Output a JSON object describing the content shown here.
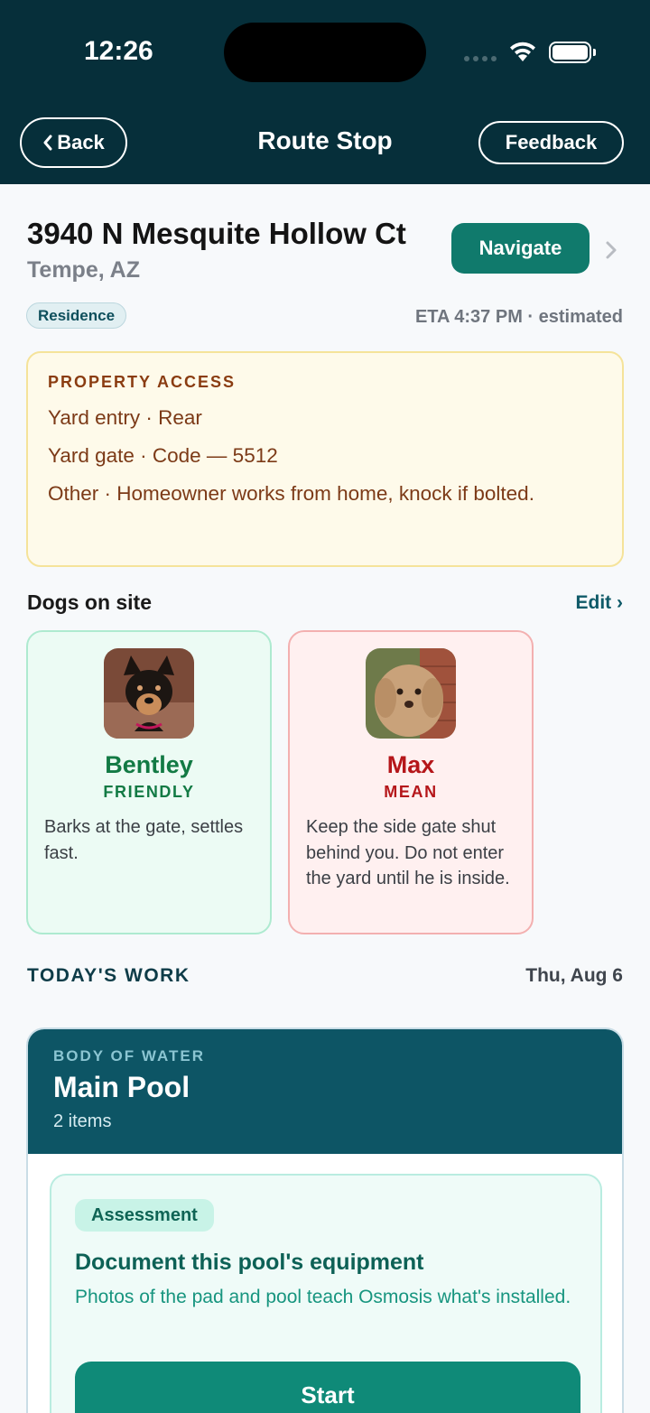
{
  "status_bar": {
    "time": "12:26"
  },
  "header": {
    "back_label": "Back",
    "title": "Route Stop",
    "feedback_label": "Feedback"
  },
  "stop": {
    "address": "3940 N Mesquite Hollow Ct",
    "city": "Tempe, AZ",
    "navigate_label": "Navigate",
    "type_badge": "Residence",
    "eta": "ETA 4:37 PM · estimated"
  },
  "property_access": {
    "title": "PROPERTY ACCESS",
    "lines": [
      "Yard entry · Rear",
      "Yard gate · Code — 5512",
      "Other · Homeowner works from home, knock if bolted."
    ]
  },
  "dogs": {
    "title": "Dogs on site",
    "edit_label": "Edit ›",
    "items": [
      {
        "name": "Bentley",
        "mood": "FRIENDLY",
        "note": "Barks at the gate, settles fast."
      },
      {
        "name": "Max",
        "mood": "MEAN",
        "note": "Keep the side gate shut behind you. Do not enter the yard until he is inside."
      }
    ]
  },
  "work": {
    "title": "TODAY'S WORK",
    "date": "Thu, Aug 6",
    "body_of_water": {
      "kicker": "BODY OF WATER",
      "name": "Main Pool",
      "count": "2 items",
      "task": {
        "badge": "Assessment",
        "title": "Document this pool's equipment",
        "description": "Photos of the pad and pool teach Osmosis what's installed.",
        "action_label": "Start"
      }
    }
  }
}
